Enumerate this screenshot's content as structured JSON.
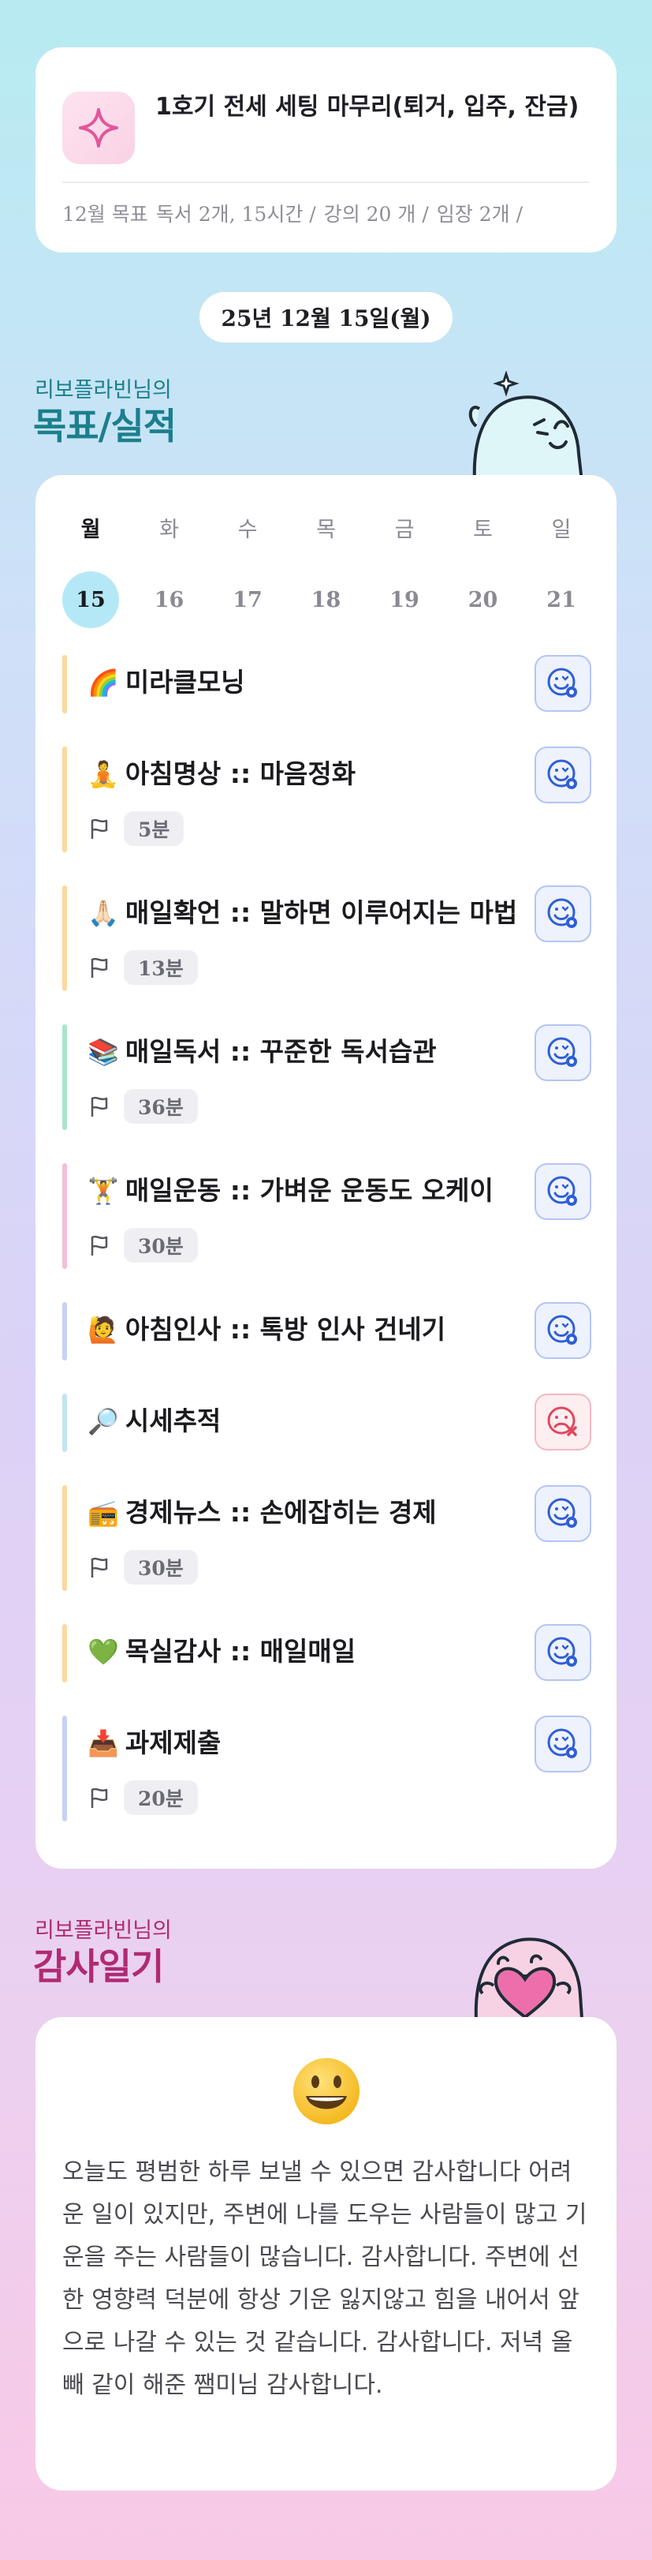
{
  "goal": {
    "icon": "sparkle-icon",
    "title": "1호기 전세 세팅 마무리(퇴거, 입주, 잔금)",
    "meta": [
      "12월 목표",
      "독서 2개, 15시간 /",
      "강의 20 개 /",
      "임장 2개 /"
    ]
  },
  "date": "25년 12월 15일(월)",
  "routine_section": {
    "subtitle": "리보플라빈님의",
    "title": "목표/실적"
  },
  "week": {
    "days": [
      "월",
      "화",
      "수",
      "목",
      "금",
      "토",
      "일"
    ],
    "dates": [
      "15",
      "16",
      "17",
      "18",
      "19",
      "20",
      "21"
    ],
    "active_index": 0
  },
  "routines": [
    {
      "emoji": "🌈",
      "name": "미라클모닝",
      "duration": "",
      "status": "done",
      "bar": "#fcd89e"
    },
    {
      "emoji": "🧘",
      "name": "아침명상 :: 마음정화",
      "duration": "5분",
      "status": "done",
      "bar": "#fcd89e"
    },
    {
      "emoji": "🙏🏻",
      "name": "매일확언 :: 말하면 이루어지는 마법",
      "duration": "13분",
      "status": "done",
      "bar": "#fcd89e"
    },
    {
      "emoji": "📚",
      "name": "매일독서 :: 꾸준한 독서습관",
      "duration": "36분",
      "status": "done",
      "bar": "#a8e6c8"
    },
    {
      "emoji": "🏋",
      "name": "매일운동 :: 가벼운 운동도 오케이",
      "duration": "30분",
      "status": "done",
      "bar": "#f8bcd8"
    },
    {
      "emoji": "🙋",
      "name": "아침인사 :: 톡방 인사 건네기",
      "duration": "",
      "status": "done",
      "bar": "#c7d2f4"
    },
    {
      "emoji": "🔎",
      "name": "시세추적",
      "duration": "",
      "status": "failed",
      "bar": "#c5e4f2"
    },
    {
      "emoji": "📻",
      "name": "경제뉴스 :: 손에잡히는 경제",
      "duration": "30분",
      "status": "done",
      "bar": "#fcd89e"
    },
    {
      "emoji": "💚",
      "name": "목실감사 :: 매일매일",
      "duration": "",
      "status": "done",
      "bar": "#fcd89e"
    },
    {
      "emoji": "📥",
      "name": "과제제출",
      "duration": "20분",
      "status": "done",
      "bar": "#c7d2f4"
    }
  ],
  "thanks_section": {
    "subtitle": "리보플라빈님의",
    "title": "감사일기"
  },
  "thanks": {
    "icon": "grinning-face-icon",
    "text": "오늘도 평범한 하루 보낼 수 있으면 감사합니다 어려운 일이 있지만, 주변에 나를 도우는 사람들이 많고 기운을 주는 사람들이 많습니다. 감사합니다. 주변에 선한 영향력 덕분에 항상 기운 잃지않고 힘을 내어서 앞으로 나갈 수 있는 것 같습니다. 감사합니다. 저녁 올빼 같이 해준 쨈미님 감사합니다."
  },
  "colors": {
    "title_teal": "#1b7f8c",
    "title_purple": "#b02a73",
    "done_icon": "#2f5fd6",
    "fail_icon": "#e0485e"
  }
}
